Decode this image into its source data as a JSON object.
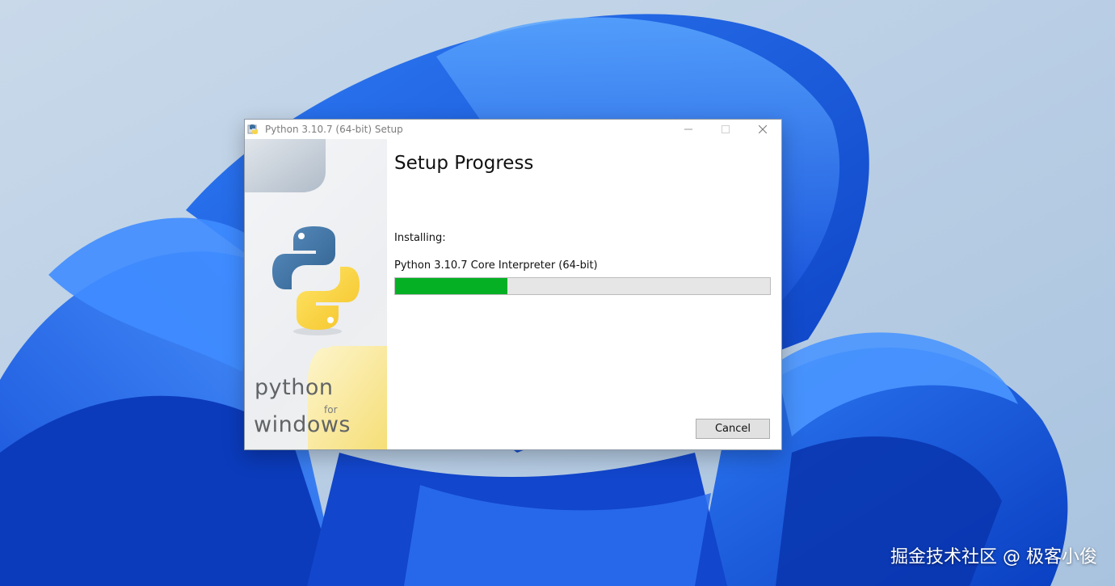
{
  "window": {
    "title": "Python 3.10.7 (64-bit) Setup",
    "minimize_icon": "minimize-icon",
    "maximize_icon": "maximize-icon",
    "close_icon": "close-icon"
  },
  "side_panel": {
    "logo_word_1": "python",
    "logo_word_2": "for",
    "logo_word_3": "windows"
  },
  "main": {
    "heading": "Setup Progress",
    "status_label": "Installing:",
    "current_item": "Python 3.10.7 Core Interpreter (64-bit)",
    "progress_fraction": 0.3,
    "cancel_label": "Cancel"
  },
  "watermark": "掘金技术社区 @ 极客小俊",
  "colors": {
    "progress_fill": "#06b025",
    "desktop_blue": "#1f5fe6",
    "python_blue": "#3b6fa0",
    "python_yellow": "#f7d64a"
  }
}
